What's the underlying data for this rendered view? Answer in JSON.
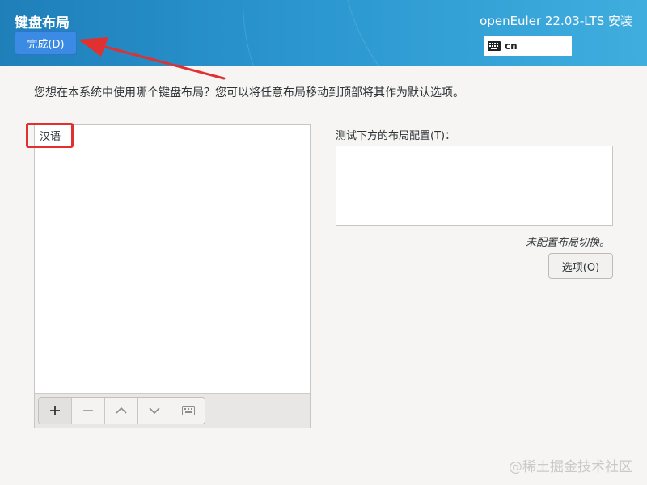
{
  "header": {
    "title": "键盘布局",
    "done_label": "完成(D)",
    "product": "openEuler 22.03-LTS 安装",
    "language_code": "cn",
    "language_icon": "keyboard-icon"
  },
  "main": {
    "instruction": "您想在本系统中使用哪个键盘布局？您可以将任意布局移动到顶部将其作为默认选项。",
    "layouts": [
      "汉语"
    ],
    "toolbar": [
      "add-icon",
      "remove-icon",
      "move-up-icon",
      "move-down-icon",
      "keyboard-preview-icon"
    ],
    "test_label": "测试下方的布局配置(T)：",
    "test_value": "",
    "switch_note": "未配置布局切换。",
    "options_label": "选项(O)"
  },
  "watermark": "@稀土掘金技术社区",
  "colors": {
    "header_start": "#1f7fb9",
    "header_end": "#3faede",
    "done_button": "#3b8ae3",
    "annotation_red": "#e03030"
  }
}
